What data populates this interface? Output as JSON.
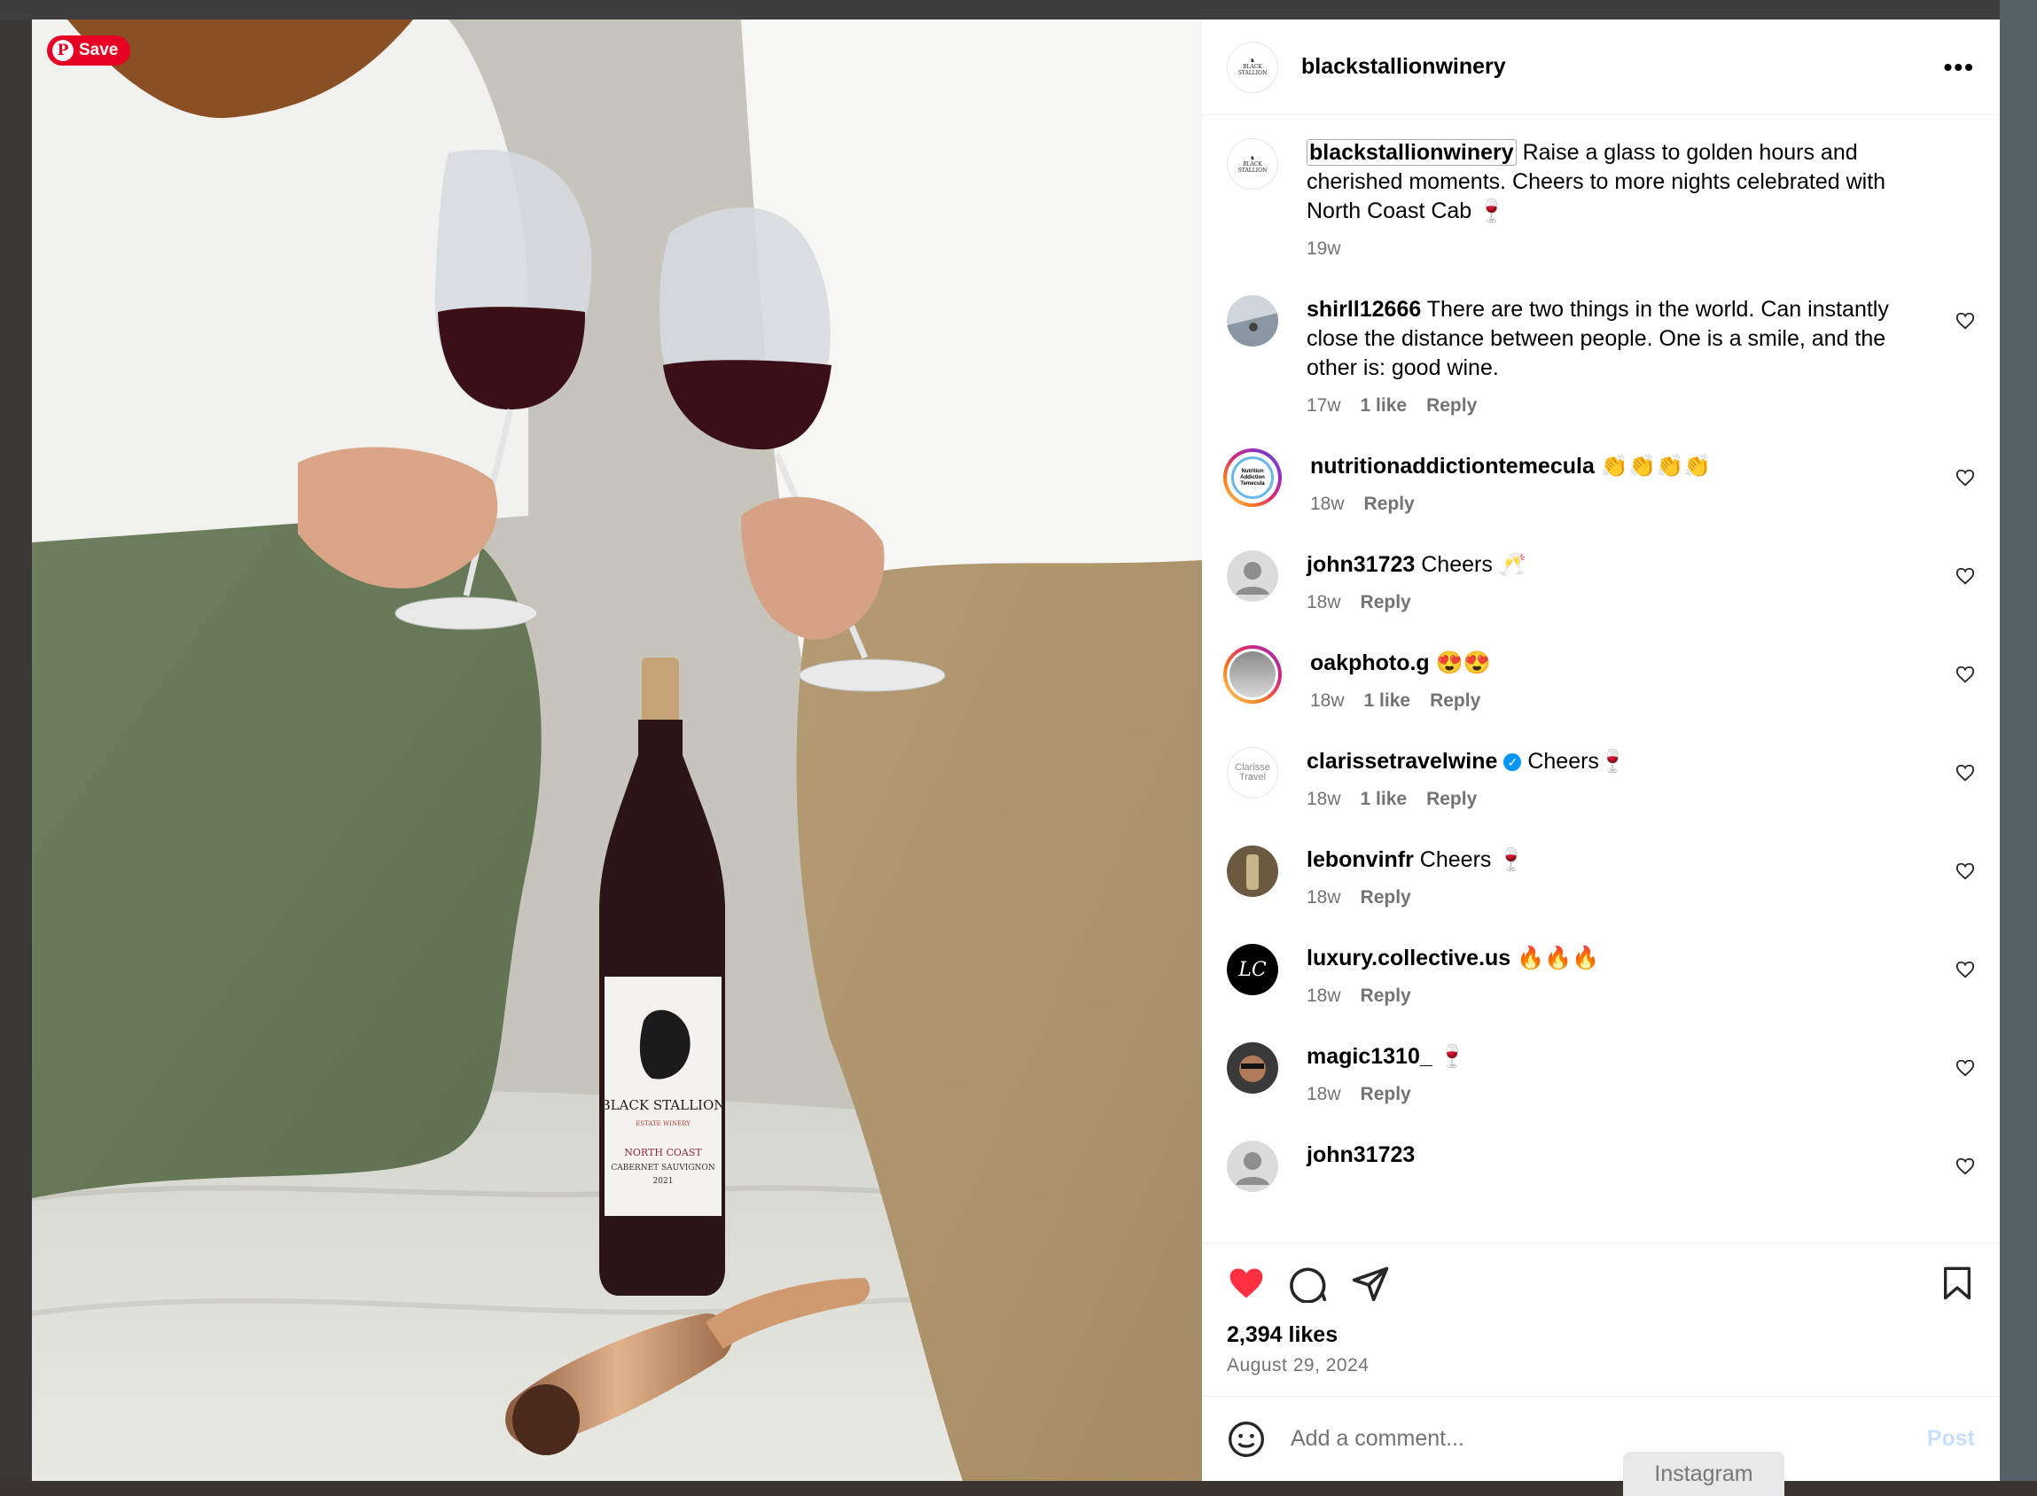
{
  "pinterest": {
    "save_label": "Save"
  },
  "post": {
    "username": "blackstallionwinery",
    "more_icon": "more-horizontal-icon",
    "caption": {
      "username": "blackstallionwinery",
      "text": "Raise a glass to golden hours and cherished moments. Cheers to more nights celebrated with North Coast Cab 🍷",
      "time": "19w"
    },
    "comments": [
      {
        "username": "shirll12666",
        "text": "There are two things in the world. Can instantly close the distance between people. One is a smile, and the other is: good wine.",
        "time": "17w",
        "likes": "1 like",
        "reply": "Reply"
      },
      {
        "username": "nutritionaddictiontemecula",
        "text": "👏👏👏👏",
        "time": "18w",
        "likes": "",
        "reply": "Reply"
      },
      {
        "username": "john31723",
        "text": "Cheers 🥂",
        "time": "18w",
        "likes": "",
        "reply": "Reply"
      },
      {
        "username": "oakphoto.g",
        "text": "😍😍",
        "time": "18w",
        "likes": "1 like",
        "reply": "Reply"
      },
      {
        "username": "clarissetravelwine",
        "text": "Cheers🍷",
        "time": "18w",
        "likes": "1 like",
        "reply": "Reply"
      },
      {
        "username": "lebonvinfr",
        "text": "Cheers 🍷",
        "time": "18w",
        "likes": "",
        "reply": "Reply"
      },
      {
        "username": "luxury.collective.us",
        "text": "🔥🔥🔥",
        "time": "18w",
        "likes": "",
        "reply": "Reply"
      },
      {
        "username": "magic1310_",
        "text": "🍷",
        "time": "18w",
        "likes": "",
        "reply": "Reply"
      },
      {
        "username": "john31723",
        "text": "",
        "time": "",
        "likes": "",
        "reply": ""
      }
    ],
    "likes": "2,394 likes",
    "date": "August 29, 2024",
    "add_comment_placeholder": "Add a comment...",
    "post_label": "Post",
    "avatar_texts": {
      "nutrition": "Nutrition Addiction Temecula",
      "clarisse": "Clarisse Travel",
      "luxury": "LC"
    }
  },
  "photo_labels": {
    "brand": "BLACK STALLION",
    "winery": "ESTATE WINERY",
    "region": "NORTH COAST",
    "varietal": "CABERNET SAUVIGNON",
    "vintage": "2021"
  },
  "bottom_tab": "Instagram",
  "colors": {
    "like_red": "#ff3040",
    "link_blue": "#0095f6",
    "post_disabled": "#c7dffa",
    "pinterest_red": "#e60023"
  }
}
